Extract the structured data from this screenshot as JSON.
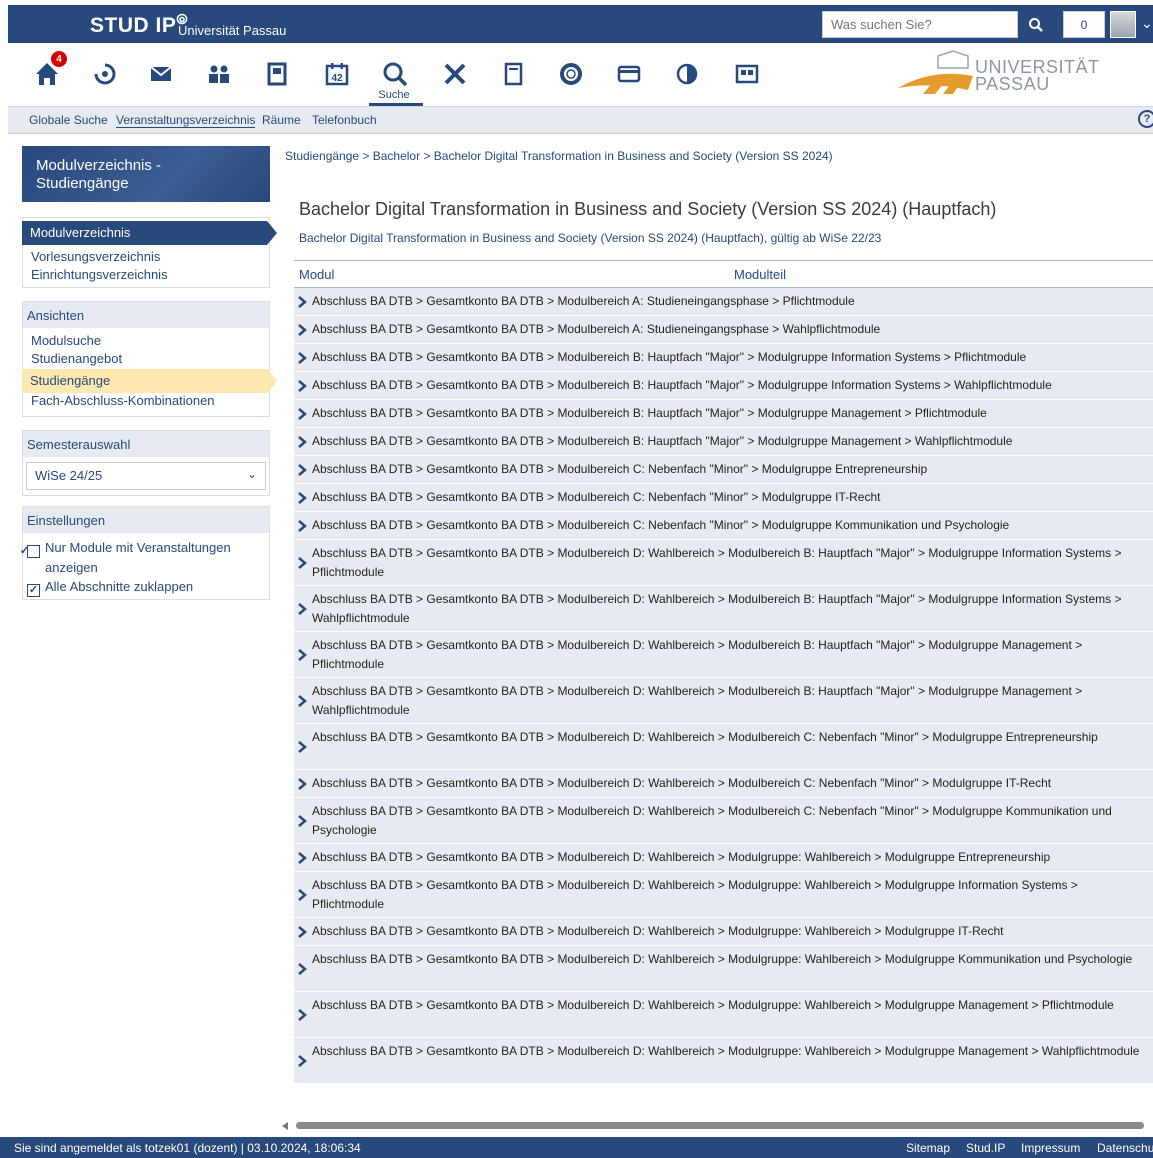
{
  "header": {
    "logo": "STUD IP",
    "university": "Universität Passau",
    "search_placeholder": "Was suchen Sie?",
    "notification_count": "0"
  },
  "nav": {
    "home_badge": "4",
    "search_label": "Suche",
    "calendar_day": "42",
    "uni_logo_line1": "UNIVERSITÄT",
    "uni_logo_line2": "PASSAU",
    "icons": [
      "home-icon",
      "activity-icon",
      "mail-icon",
      "community-icon",
      "profile-icon",
      "calendar-icon",
      "search-icon",
      "tools-icon",
      "files-icon",
      "help-ring-icon",
      "card-icon",
      "stats-icon",
      "blubber-icon"
    ]
  },
  "subnav": [
    "Globale Suche",
    "Veranstaltungsverzeichnis",
    "Räume",
    "Telefonbuch"
  ],
  "sidebar": {
    "title": "Modulverzeichnis - Studiengänge",
    "directories": [
      "Modulverzeichnis",
      "Vorlesungsverzeichnis",
      "Einrichtungsverzeichnis"
    ],
    "views_heading": "Ansichten",
    "views": [
      "Modulsuche",
      "Studienangebot",
      "Studiengänge",
      "Fach-Abschluss-Kombinationen"
    ],
    "semester_heading": "Semesterauswahl",
    "semester_value": "WiSe 24/25",
    "settings_heading": "Einstellungen",
    "settings": [
      "Nur Module mit Veranstaltungen anzeigen",
      "Alle Abschnitte zuklappen"
    ]
  },
  "main": {
    "breadcrumb": "Studiengänge > Bachelor > Bachelor Digital Transformation in Business and Society (Version SS 2024)",
    "title": "Bachelor Digital Transformation in Business and Society (Version SS 2024) (Hauptfach)",
    "subtitle": "Bachelor Digital Transformation in Business and Society (Version SS 2024) (Hauptfach), gültig ab WiSe 22/23",
    "col_modul": "Modul",
    "col_modulteil": "Modulteil",
    "rows": [
      "Abschluss BA DTB > Gesamtkonto BA DTB > Modulbereich A: Studieneingangsphase > Pflichtmodule",
      "Abschluss BA DTB > Gesamtkonto BA DTB > Modulbereich A: Studieneingangsphase > Wahlpflichtmodule",
      "Abschluss BA DTB > Gesamtkonto BA DTB > Modulbereich B: Hauptfach \"Major\" > Modulgruppe Information Systems > Pflichtmodule",
      "Abschluss BA DTB > Gesamtkonto BA DTB > Modulbereich B: Hauptfach \"Major\" > Modulgruppe Information Systems > Wahlpflichtmodule",
      "Abschluss BA DTB > Gesamtkonto BA DTB > Modulbereich B: Hauptfach \"Major\" > Modulgruppe Management > Pflichtmodule",
      "Abschluss BA DTB > Gesamtkonto BA DTB > Modulbereich B: Hauptfach \"Major\" > Modulgruppe Management > Wahlpflichtmodule",
      "Abschluss BA DTB > Gesamtkonto BA DTB > Modulbereich C: Nebenfach \"Minor\" > Modulgruppe Entrepreneurship",
      "Abschluss BA DTB > Gesamtkonto BA DTB > Modulbereich C: Nebenfach \"Minor\" > Modulgruppe IT-Recht",
      "Abschluss BA DTB > Gesamtkonto BA DTB > Modulbereich C: Nebenfach \"Minor\" > Modulgruppe Kommunikation und Psychologie",
      "Abschluss BA DTB > Gesamtkonto BA DTB > Modulbereich D: Wahlbereich > Modulbereich B: Hauptfach \"Major\" > Modulgruppe Information Systems > Pflichtmodule",
      "Abschluss BA DTB > Gesamtkonto BA DTB > Modulbereich D: Wahlbereich > Modulbereich B: Hauptfach \"Major\" > Modulgruppe Information Systems > Wahlpflichtmodule",
      "Abschluss BA DTB > Gesamtkonto BA DTB > Modulbereich D: Wahlbereich > Modulbereich B: Hauptfach \"Major\" > Modulgruppe Management > Pflichtmodule",
      "Abschluss BA DTB > Gesamtkonto BA DTB > Modulbereich D: Wahlbereich > Modulbereich B: Hauptfach \"Major\" > Modulgruppe Management > Wahlpflichtmodule",
      "Abschluss BA DTB > Gesamtkonto BA DTB > Modulbereich D: Wahlbereich > Modulbereich C: Nebenfach \"Minor\" > Modulgruppe Entrepreneurship",
      "Abschluss BA DTB > Gesamtkonto BA DTB > Modulbereich D: Wahlbereich > Modulbereich C: Nebenfach \"Minor\" > Modulgruppe IT-Recht",
      "Abschluss BA DTB > Gesamtkonto BA DTB > Modulbereich D: Wahlbereich > Modulbereich C: Nebenfach \"Minor\" > Modulgruppe Kommunikation und Psychologie",
      "Abschluss BA DTB > Gesamtkonto BA DTB > Modulbereich D: Wahlbereich > Modulgruppe: Wahlbereich > Modulgruppe Entrepreneurship",
      "Abschluss BA DTB > Gesamtkonto BA DTB > Modulbereich D: Wahlbereich > Modulgruppe: Wahlbereich > Modulgruppe Information Systems > Pflichtmodule",
      "Abschluss BA DTB > Gesamtkonto BA DTB > Modulbereich D: Wahlbereich > Modulgruppe: Wahlbereich > Modulgruppe IT-Recht",
      "Abschluss BA DTB > Gesamtkonto BA DTB > Modulbereich D: Wahlbereich > Modulgruppe: Wahlbereich > Modulgruppe Kommunikation und Psychologie",
      "Abschluss BA DTB > Gesamtkonto BA DTB > Modulbereich D: Wahlbereich > Modulgruppe: Wahlbereich > Modulgruppe Management > Pflichtmodule",
      "Abschluss BA DTB > Gesamtkonto BA DTB > Modulbereich D: Wahlbereich > Modulgruppe: Wahlbereich > Modulgruppe Management > Wahlpflichtmodule"
    ]
  },
  "footer": {
    "status": "Sie sind angemeldet als totzek01 (dozent) | 03.10.2024, 18:06:34",
    "links": [
      "Sitemap",
      "Stud.IP",
      "Impressum",
      "Datenschu"
    ]
  },
  "colors": {
    "primary": "#28497c",
    "sidebar_active": "#fde9b0",
    "row_bg": "#e7ebf1",
    "badge": "#d60000"
  }
}
